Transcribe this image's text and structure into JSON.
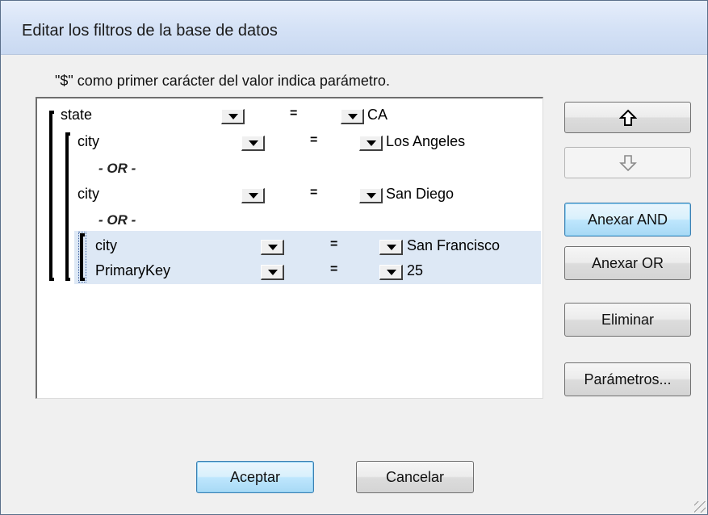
{
  "window": {
    "title": "Editar los filtros de la base de datos"
  },
  "hint": "\"$\" como primer carácter del valor indica parámetro.",
  "filters": [
    {
      "field": "state",
      "operator": "=",
      "value": "CA"
    },
    {
      "field": "city",
      "operator": "=",
      "value": "Los Angeles"
    },
    {
      "connector": "- OR -"
    },
    {
      "field": "city",
      "operator": "=",
      "value": "San Diego"
    },
    {
      "connector": "- OR -"
    },
    {
      "field": "city",
      "operator": "=",
      "value": "San Francisco",
      "selected": true
    },
    {
      "field": "PrimaryKey",
      "operator": "=",
      "value": "25",
      "selected": true
    }
  ],
  "side_buttons": {
    "move_up": "up-arrow-icon",
    "move_down": "down-arrow-icon",
    "append_and": "Anexar AND",
    "append_or": "Anexar OR",
    "delete": "Eliminar",
    "parameters": "Parámetros..."
  },
  "footer": {
    "ok": "Aceptar",
    "cancel": "Cancelar"
  },
  "colors": {
    "selection": "#dde8f5",
    "titlebar": "#d5e2f6",
    "default_button": "#bee6fd"
  }
}
